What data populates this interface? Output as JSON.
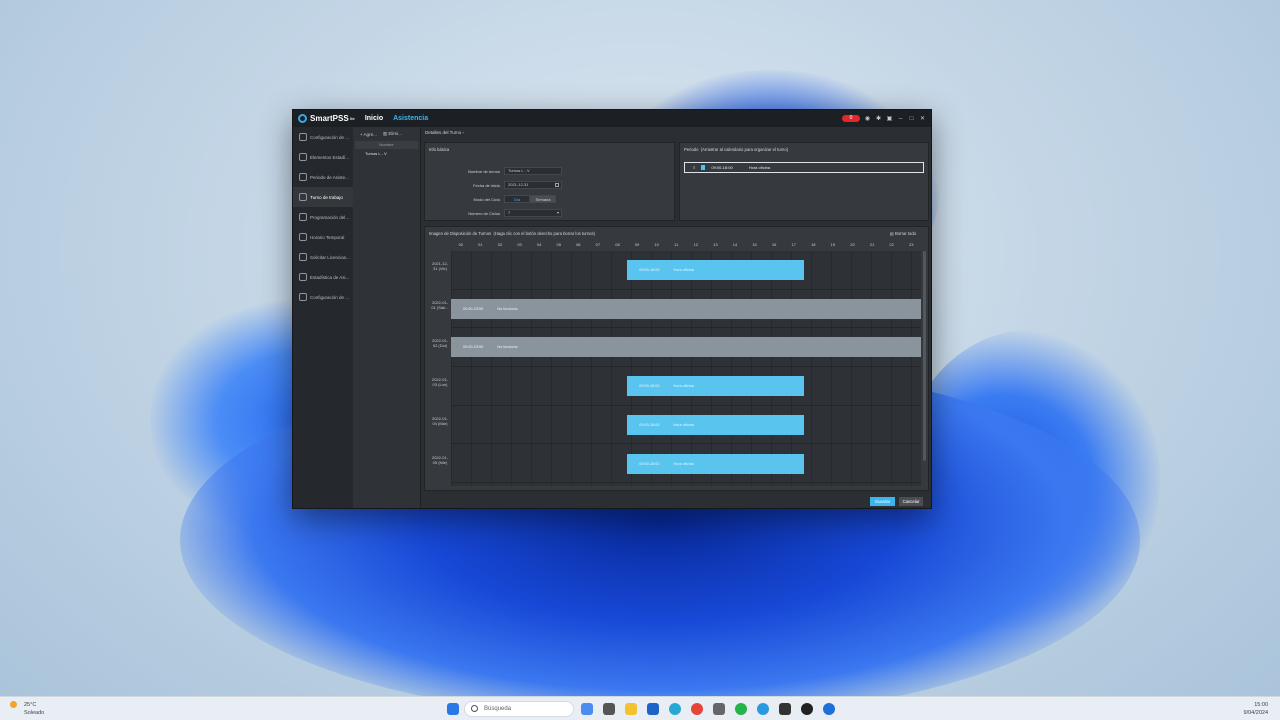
{
  "app": {
    "name": "SmartPSS",
    "name_sup": "lite",
    "tabs": [
      "Inicio",
      "Asistencia"
    ],
    "rec_label": "0"
  },
  "sidebar": {
    "items": [
      {
        "label": "Configuración de ..."
      },
      {
        "label": "Elementos Estadí..."
      },
      {
        "label": "Periodo de Asiste..."
      },
      {
        "label": "Turno de trabajo"
      },
      {
        "label": "Programación del..."
      },
      {
        "label": "Horario Temporal"
      },
      {
        "label": "Solicitar Licencias..."
      },
      {
        "label": "Estadística de Asi..."
      },
      {
        "label": "Configuración de ..."
      }
    ]
  },
  "list_panel": {
    "add_label": "Agre...",
    "delete_label": "Elimi...",
    "column_header": "Nombre",
    "rows": [
      "Turnos L - V"
    ]
  },
  "breadcrumb": "Detalles del Turno",
  "info_basica": {
    "title": "Info básica",
    "name_label": "Nombre de turnos",
    "name_value": "Turnos L - V",
    "start_label": "Fecha de inicio",
    "start_value": "2021-12-31",
    "mode_label": "Modo del Ciclo",
    "mode_day": "Día",
    "mode_week": "Semana",
    "cycles_label": "Número de Ciclos",
    "cycles_value": "7"
  },
  "periodo": {
    "title": "Periodo",
    "hint": "(Arrastrar al calendario para organizar el turno)",
    "row_time": "09:00-18:00",
    "row_name": "Hora oficina"
  },
  "schedule": {
    "title": "Imagen de Disposición de Turnos",
    "hint": "(Haga clic con el botón derecho para borrar los turnos)",
    "clear_label": "Borrar todo",
    "hours": [
      "00",
      "01",
      "02",
      "03",
      "04",
      "05",
      "06",
      "07",
      "08",
      "09",
      "10",
      "11",
      "12",
      "13",
      "14",
      "15",
      "16",
      "17",
      "18",
      "19",
      "20",
      "21",
      "22",
      "23"
    ],
    "days": [
      {
        "label": "2021-12-31 (Vie)",
        "type": "work",
        "time": "09:00-18:00",
        "name": "Hora oficina"
      },
      {
        "label": "2022-01-01 (Sáb...",
        "type": "off",
        "time": "00:00-23:59",
        "name": "No funciona"
      },
      {
        "label": "2022-01-02 (Dol)",
        "type": "off",
        "time": "00:00-23:59",
        "name": "No funciona"
      },
      {
        "label": "2022-01-03 (Lun)",
        "type": "work",
        "time": "09:00-18:00",
        "name": "Hora oficina"
      },
      {
        "label": "2022-01-04 (Mar)",
        "type": "work",
        "time": "09:00-18:00",
        "name": "Hora oficina"
      },
      {
        "label": "2022-01-05 (Mie)",
        "type": "work",
        "time": "09:00-18:00",
        "name": "Hora oficina"
      }
    ]
  },
  "footer": {
    "save_label": "Guardar",
    "cancel_label": "Cancelar"
  },
  "taskbar": {
    "temp": "25°C",
    "weather": "Soleado",
    "search_placeholder": "Búsqueda",
    "time": "15:00",
    "date": "9/04/2024"
  },
  "colors": {
    "accent": "#39b6f0",
    "work_shift": "#59c5ef",
    "off_shift": "#8a949c"
  }
}
